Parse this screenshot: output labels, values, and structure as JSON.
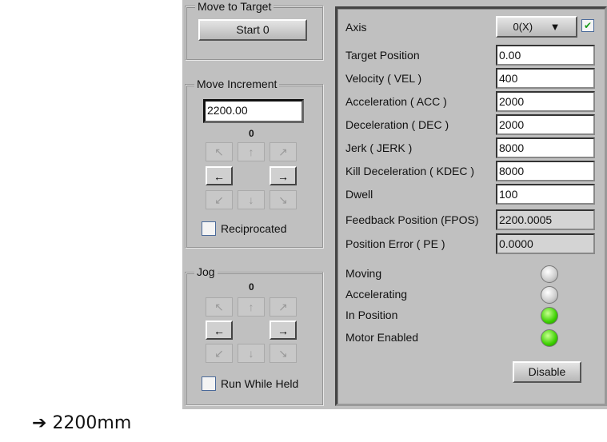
{
  "move_to_target": {
    "title": "Move to Target",
    "start_label": "Start 0"
  },
  "move_increment": {
    "title": "Move Increment",
    "value": "2200.00",
    "counter": "0",
    "reciprocated_label": "Reciprocated",
    "reciprocated": false
  },
  "jog": {
    "title": "Jog",
    "counter": "0",
    "run_while_held_label": "Run While Held",
    "run_while_held": false
  },
  "arrows": {
    "nw": "↖",
    "n": "↑",
    "ne": "↗",
    "w": "←",
    "e": "→",
    "sw": "↙",
    "s": "↓",
    "se": "↘"
  },
  "axis": {
    "label": "Axis",
    "selected": "0(X)",
    "enabled": true
  },
  "params": [
    {
      "label": "Target Position",
      "value": "0.00"
    },
    {
      "label": "Velocity ( VEL )",
      "value": "400"
    },
    {
      "label": "Acceleration ( ACC )",
      "value": "2000"
    },
    {
      "label": "Deceleration ( DEC )",
      "value": "2000"
    },
    {
      "label": "Jerk ( JERK )",
      "value": "8000"
    },
    {
      "label": "Kill Deceleration ( KDEC )",
      "value": "8000"
    },
    {
      "label": "Dwell",
      "value": "100"
    },
    {
      "label": "Feedback Position (FPOS)",
      "value": "2200.0005"
    },
    {
      "label": "Position Error ( PE )",
      "value": "0.0000"
    }
  ],
  "status": [
    {
      "label": "Moving",
      "on": false
    },
    {
      "label": "Accelerating",
      "on": false
    },
    {
      "label": "In Position",
      "on": true
    },
    {
      "label": "Motor Enabled",
      "on": true
    }
  ],
  "disable_label": "Disable",
  "caption": {
    "arrow": "➔",
    "text": "2200mm"
  }
}
